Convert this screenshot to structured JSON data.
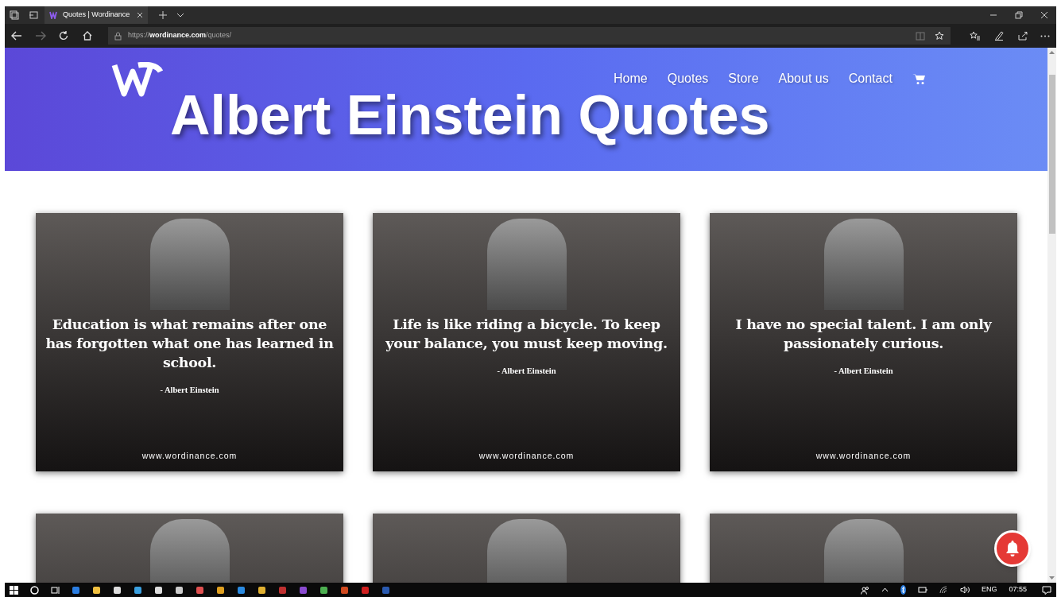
{
  "browser": {
    "tabs": [
      {
        "title": "Quotes | Wordinance",
        "selected": true
      }
    ],
    "url": "https://**wordinance.com**/quotes/"
  },
  "site": {
    "nav": [
      {
        "label": "Home"
      },
      {
        "label": "Quotes"
      },
      {
        "label": "Store"
      },
      {
        "label": "About us"
      },
      {
        "label": "Contact"
      }
    ],
    "hero_title": "Albert Einstein Quotes"
  },
  "quote_cards": [
    {
      "quote": "Education is what remains after one has forgotten what one has learned in school.",
      "author": "- Albert Einstein",
      "footer": "www.wordinance.com"
    },
    {
      "quote": "Life is like riding a bicycle. To keep your balance, you must keep moving.",
      "author": "- Albert Einstein",
      "footer": "www.wordinance.com"
    },
    {
      "quote": "I have no special talent. I am only passionately curious.",
      "author": "- Albert Einstein",
      "footer": "www.wordinance.com"
    }
  ],
  "lower_cards": [
    {
      "kind": "photo"
    },
    {
      "kind": "photo"
    },
    {
      "kind": "photo"
    }
  ],
  "taskbar": {
    "language": "ENG",
    "time": "07:55"
  }
}
